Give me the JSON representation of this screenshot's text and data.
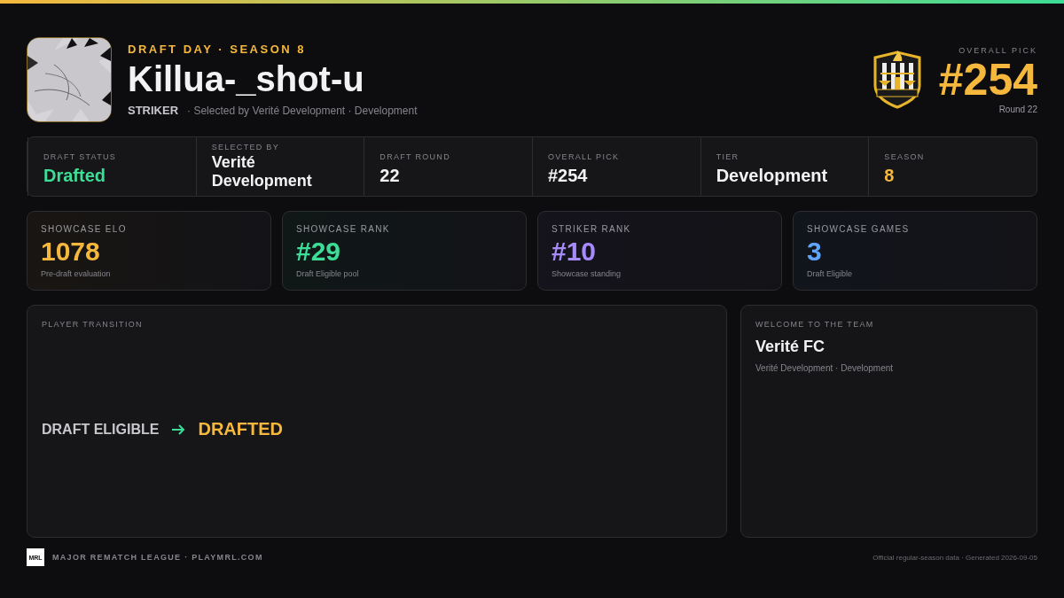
{
  "header": {
    "eyebrow": "DRAFT DAY · SEASON 8",
    "player_name": "Killua-_shot-u",
    "position": "STRIKER",
    "subtitle": "· Selected by Verité Development · Development",
    "pick_label": "OVERALL PICK",
    "pick_number": "#254",
    "pick_round": "Round 22"
  },
  "info": [
    {
      "label": "DRAFT STATUS",
      "value": "Drafted",
      "color": "#3ddc97"
    },
    {
      "label": "SELECTED BY",
      "value": "Verité Development",
      "color": "#f2f2f4"
    },
    {
      "label": "DRAFT ROUND",
      "value": "22",
      "color": "#f2f2f4"
    },
    {
      "label": "OVERALL PICK",
      "value": "#254",
      "color": "#f2f2f4"
    },
    {
      "label": "TIER",
      "value": "Development",
      "color": "#f2f2f4"
    },
    {
      "label": "SEASON",
      "value": "8",
      "color": "#f5b83d"
    }
  ],
  "stats": [
    {
      "label": "SHOWCASE ELO",
      "value": "1078",
      "note": "Pre-draft evaluation",
      "color": "#f5b83d"
    },
    {
      "label": "SHOWCASE RANK",
      "value": "#29",
      "note": "Draft Eligible pool",
      "color": "#3ddc97"
    },
    {
      "label": "STRIKER RANK",
      "value": "#10",
      "note": "Showcase standing",
      "color": "#a78bfa"
    },
    {
      "label": "SHOWCASE GAMES",
      "value": "3",
      "note": "Draft Eligible",
      "color": "#60a5fa"
    }
  ],
  "transition": {
    "title": "PLAYER TRANSITION",
    "from": "DRAFT ELIGIBLE",
    "to": "DRAFTED"
  },
  "welcome": {
    "title": "WELCOME TO THE TEAM",
    "team": "Verité FC",
    "detail": "Verité Development · Development"
  },
  "footer": {
    "logo_text": "MRL",
    "league": "MAJOR REMATCH LEAGUE · PLAYMRL.COM",
    "note": "Official regular-season data · Generated 2026-09-05"
  }
}
